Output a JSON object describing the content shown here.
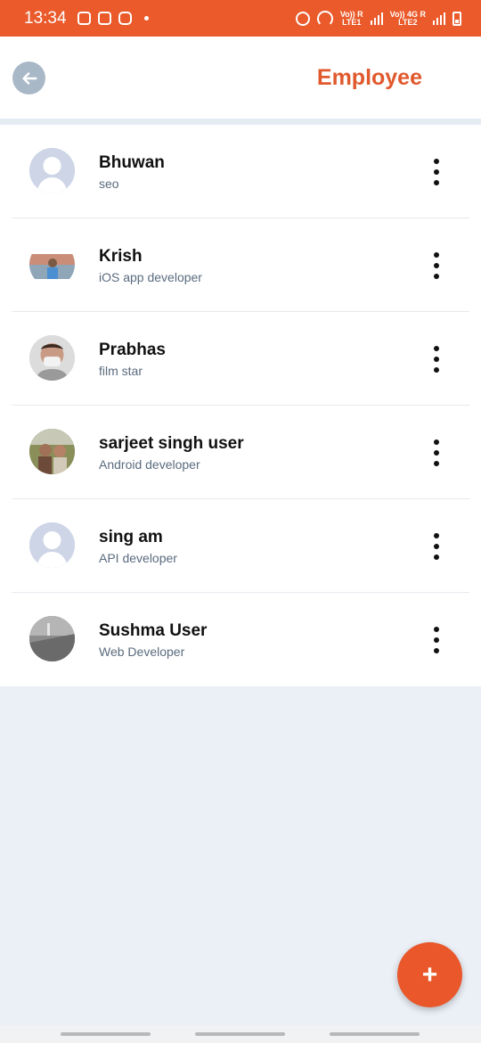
{
  "status_bar": {
    "time": "13:34",
    "net1": "Vo)) R\nLTE1",
    "net2": "Vo)) 4G R\nLTE2"
  },
  "header": {
    "title": "Employee",
    "back_icon": "arrow-left-icon"
  },
  "employees": [
    {
      "name": "Bhuwan",
      "role": "seo",
      "avatar": "placeholder"
    },
    {
      "name": "Krish",
      "role": "iOS app developer",
      "avatar": "photo"
    },
    {
      "name": "Prabhas",
      "role": "film star",
      "avatar": "photo"
    },
    {
      "name": "sarjeet singh user",
      "role": "Android developer",
      "avatar": "photo"
    },
    {
      "name": "sing am",
      "role": "API developer",
      "avatar": "placeholder"
    },
    {
      "name": "Sushma User",
      "role": "Web Developer",
      "avatar": "photo"
    }
  ],
  "fab": {
    "label": "+",
    "icon": "plus-icon"
  },
  "colors": {
    "accent": "#e9572b",
    "title": "#e0592d",
    "background": "#ebeff6"
  }
}
